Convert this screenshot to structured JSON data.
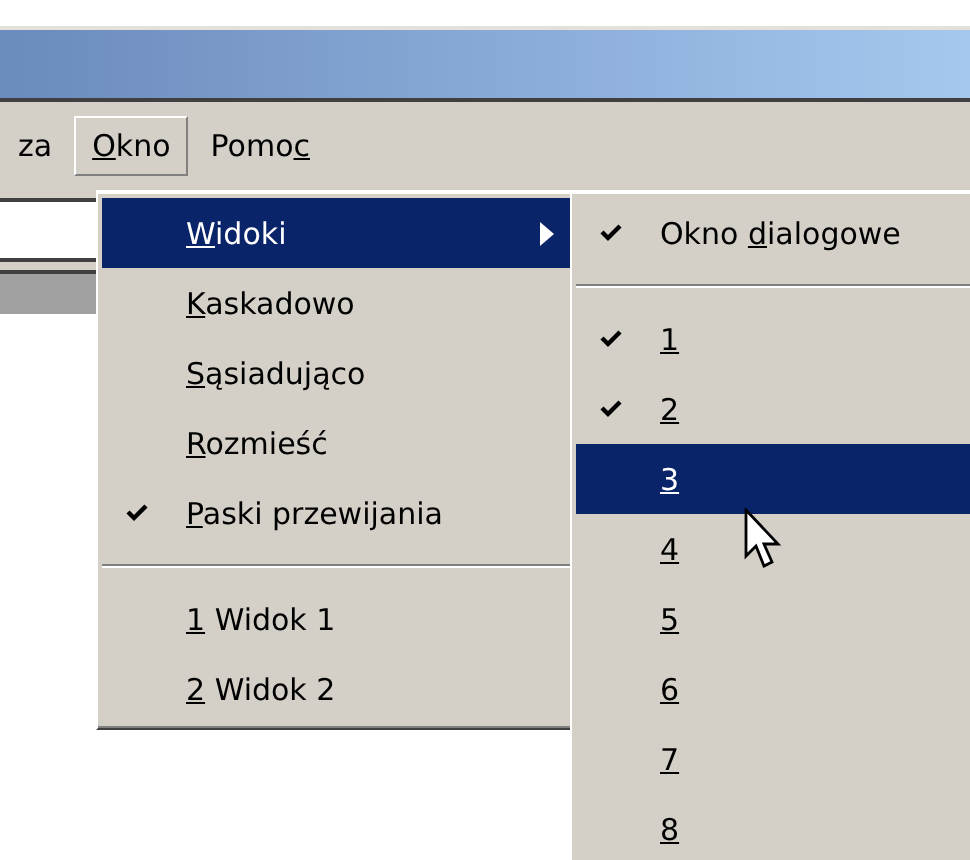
{
  "menubar": [
    {
      "post": "za",
      "selected": false
    },
    {
      "key": "O",
      "post": "kno",
      "selected": true
    },
    {
      "pre": "Pomo",
      "key": "c",
      "selected": false
    }
  ],
  "menu": {
    "items": [
      {
        "kind": "item",
        "key": "W",
        "post": "idoki",
        "checked": false,
        "submenu": true,
        "selected": true
      },
      {
        "kind": "item",
        "key": "K",
        "post": "askadowo",
        "checked": false,
        "submenu": false,
        "selected": false
      },
      {
        "kind": "item",
        "key": "S",
        "post": "ąsiadująco",
        "checked": false,
        "submenu": false,
        "selected": false
      },
      {
        "kind": "item",
        "key": "R",
        "post": "ozmieść",
        "checked": false,
        "submenu": false,
        "selected": false
      },
      {
        "kind": "item",
        "key": "P",
        "post": "aski przewijania",
        "checked": true,
        "submenu": false,
        "selected": false
      },
      {
        "kind": "separator"
      },
      {
        "kind": "item",
        "key": "1",
        "post": " Widok 1",
        "checked": false,
        "submenu": false,
        "selected": false
      },
      {
        "kind": "item",
        "key": "2",
        "post": " Widok 2",
        "checked": false,
        "submenu": false,
        "selected": false
      }
    ]
  },
  "submenu": {
    "items": [
      {
        "kind": "item",
        "pre": "Okno ",
        "key": "d",
        "post": "ialogowe",
        "checked": true,
        "selected": false
      },
      {
        "kind": "separator"
      },
      {
        "kind": "item",
        "key": "1",
        "checked": true,
        "selected": false
      },
      {
        "kind": "item",
        "key": "2",
        "checked": true,
        "selected": false
      },
      {
        "kind": "item",
        "key": "3",
        "checked": false,
        "selected": true
      },
      {
        "kind": "item",
        "key": "4",
        "checked": false,
        "selected": false
      },
      {
        "kind": "item",
        "key": "5",
        "checked": false,
        "selected": false
      },
      {
        "kind": "item",
        "key": "6",
        "checked": false,
        "selected": false
      },
      {
        "kind": "item",
        "key": "7",
        "checked": false,
        "selected": false
      },
      {
        "kind": "item",
        "key": "8",
        "checked": false,
        "selected": false
      }
    ]
  }
}
